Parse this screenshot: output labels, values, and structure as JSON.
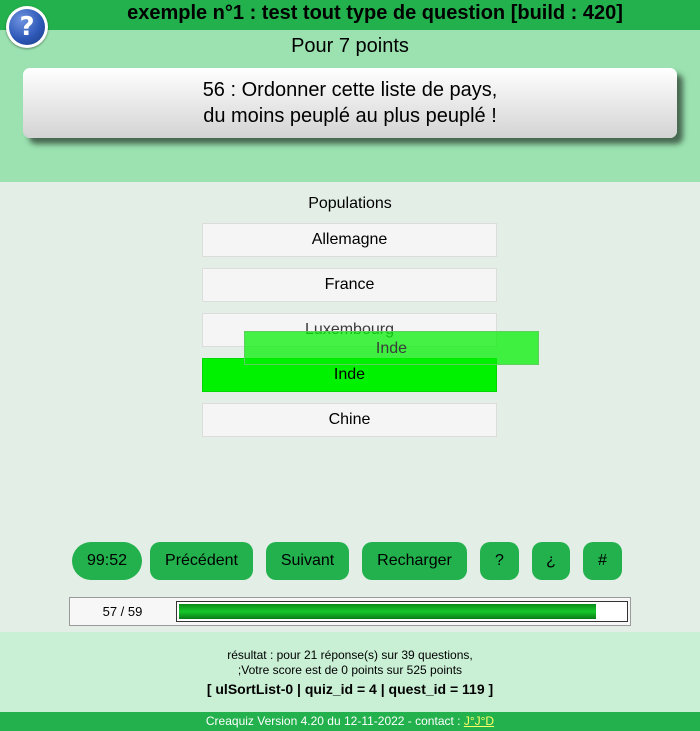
{
  "app": {
    "title": "exemple n°1 : test tout type de question [build : 420]",
    "help_icon_glyph": "?"
  },
  "question": {
    "points_label": "Pour 7 points",
    "line1": "56 : Ordonner cette liste de pays,",
    "line2": "du moins peuplé au plus peuplé !"
  },
  "sortable": {
    "title": "Populations",
    "items": [
      {
        "label": "Allemagne",
        "state": "normal"
      },
      {
        "label": "France",
        "state": "normal"
      },
      {
        "label": "Luxembourg",
        "state": "normal"
      },
      {
        "label": "Inde",
        "state": "dragging"
      },
      {
        "label": "Chine",
        "state": "normal"
      }
    ],
    "drag_ghost_label": "Inde"
  },
  "controls": {
    "timer": "99:52",
    "prev": "Précédent",
    "next": "Suivant",
    "reload": "Recharger",
    "help": "?",
    "inverse_help": "¿",
    "hash": "#"
  },
  "progress": {
    "label": "57 / 59",
    "current": 57,
    "total": 59
  },
  "result": {
    "line1": "résultat : pour 21 réponse(s) sur 39 questions,",
    "line2": ";Votre score est de 0 points sur 525 points",
    "debug": "[ ulSortList-0 | quiz_id = 4 | quest_id = 119 ]"
  },
  "footer": {
    "text": "Creaquiz Version 4.20 du 12-11-2022 - contact : ",
    "contact_link": "J°J°D"
  },
  "colors": {
    "bar_green": "#22b14c",
    "header_green": "#9be2b0",
    "active_item": "#00f200"
  }
}
